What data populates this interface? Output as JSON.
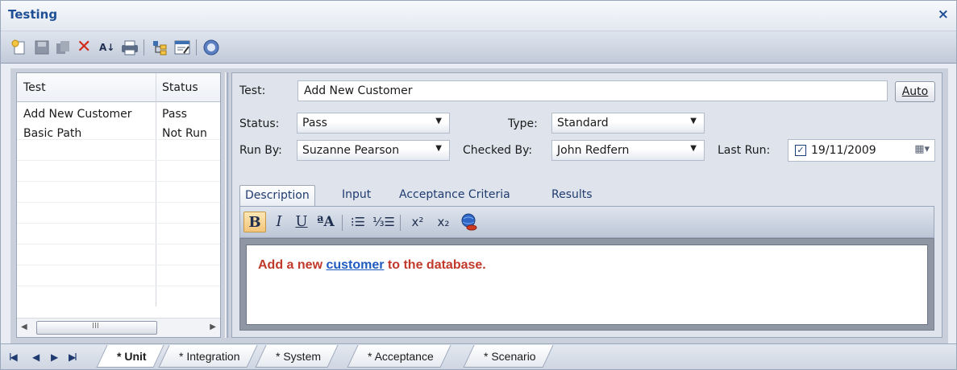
{
  "window": {
    "title": "Testing",
    "close_label": "×"
  },
  "toolbar": {
    "icons": [
      "new-item-icon",
      "save-icon",
      "copy-icon",
      "delete-icon",
      "sort-icon",
      "print-icon",
      "hierarchy-icon",
      "properties-icon",
      "help-icon"
    ],
    "delete_glyph": "✕",
    "sort_glyph": "A↓",
    "help_glyph": "?"
  },
  "grid": {
    "headers": [
      "Test",
      "Status"
    ],
    "rows": [
      {
        "test": "Add New Customer",
        "status": "Pass"
      },
      {
        "test": "Basic Path",
        "status": "Not Run"
      }
    ],
    "scroll_left": "◀",
    "scroll_right": "▶",
    "scroll_grip": "III"
  },
  "form": {
    "test_label": "Test:",
    "test_value": "Add New Customer",
    "auto_button": "Auto",
    "status_label": "Status:",
    "status_value": "Pass",
    "type_label": "Type:",
    "type_value": "Standard",
    "run_by_label": "Run By:",
    "run_by_value": "Suzanne Pearson",
    "checked_by_label": "Checked By:",
    "checked_by_value": "John Redfern",
    "last_run_label": "Last Run:",
    "last_run_checked": "✓",
    "last_run_value": "19/11/2009",
    "dropdown_glyph": "▼",
    "calendar_glyph": "▦▾"
  },
  "detail_tabs": [
    "Description",
    "Input",
    "Acceptance Criteria",
    "Results"
  ],
  "rich_toolbar": {
    "bold": "B",
    "italic": "I",
    "underline": "U",
    "font": "ªA",
    "bullets": "⁝☰",
    "numbered": "⅓☰",
    "superscript": "x²",
    "subscript": "x₂",
    "hyperlink_icon": "globe-link-icon"
  },
  "editor": {
    "text_before": "Add a new ",
    "link_text": "customer",
    "text_after": " to the database."
  },
  "bottom": {
    "nav": [
      "I◀",
      "◀",
      "▶",
      "▶I"
    ],
    "tabs": [
      "* Unit",
      "* Integration",
      "* System",
      "* Acceptance",
      "* Scenario"
    ],
    "active_tab": "* Unit"
  },
  "colors": {
    "title": "#1f4f95",
    "editor_text": "#c0392b",
    "editor_link": "#1f5bbf"
  }
}
